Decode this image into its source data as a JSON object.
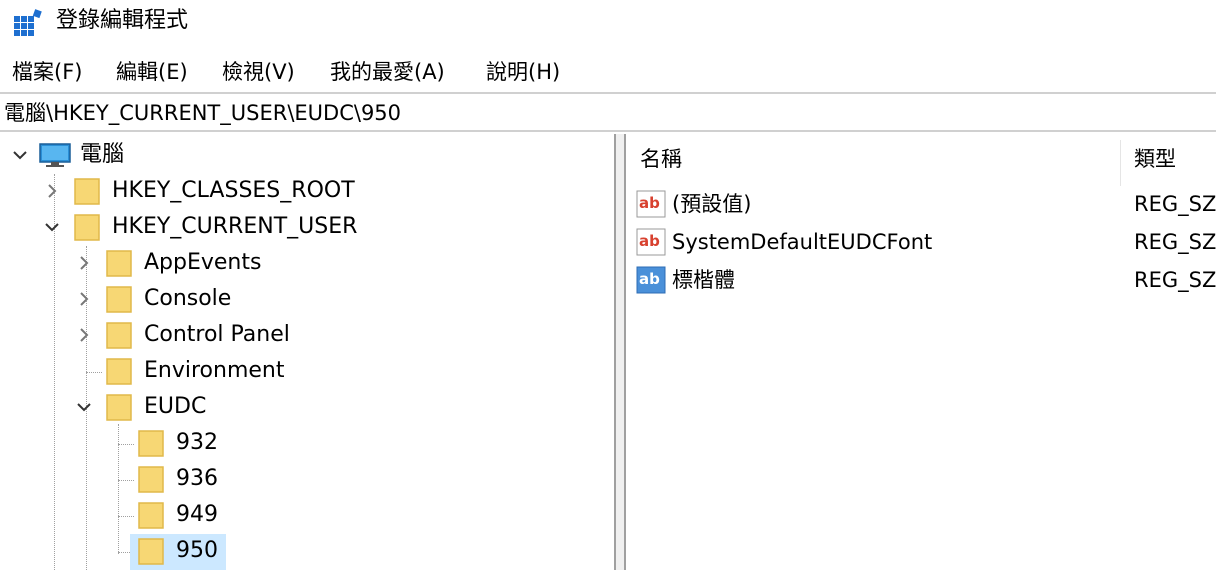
{
  "window": {
    "title": "登錄編輯程式",
    "icon": "registry-editor-icon"
  },
  "menu": [
    {
      "label": "檔案(F)"
    },
    {
      "label": "編輯(E)"
    },
    {
      "label": "檢視(V)"
    },
    {
      "label": "我的最愛(A)"
    },
    {
      "label": "說明(H)"
    }
  ],
  "address": {
    "path": "電腦\\HKEY_CURRENT_USER\\EUDC\\950"
  },
  "tree": {
    "computer": {
      "label": "電腦",
      "state": "expanded",
      "icon": "computer-icon"
    },
    "hkcr": {
      "label": "HKEY_CLASSES_ROOT",
      "state": "collapsed"
    },
    "hkcu": {
      "label": "HKEY_CURRENT_USER",
      "state": "expanded"
    },
    "appevents": {
      "label": "AppEvents",
      "state": "collapsed"
    },
    "console": {
      "label": "Console",
      "state": "collapsed"
    },
    "control_panel": {
      "label": "Control Panel",
      "state": "collapsed"
    },
    "environment": {
      "label": "Environment",
      "state": "leaf"
    },
    "eudc": {
      "label": "EUDC",
      "state": "expanded"
    },
    "k932": {
      "label": "932",
      "state": "leaf"
    },
    "k936": {
      "label": "936",
      "state": "leaf"
    },
    "k949": {
      "label": "949",
      "state": "leaf"
    },
    "k950": {
      "label": "950",
      "state": "leaf",
      "selected": true
    }
  },
  "values_pane": {
    "headers": {
      "name": "名稱",
      "type": "類型"
    },
    "rows": [
      {
        "name": "(預設值)",
        "type": "REG_SZ",
        "icon": "string-value-icon"
      },
      {
        "name": "SystemDefaultEUDCFont",
        "type": "REG_SZ",
        "icon": "string-value-icon"
      },
      {
        "name": "標楷體",
        "type": "REG_SZ",
        "icon": "string-value-selected-icon"
      }
    ]
  },
  "colors": {
    "selection": "#cce8ff",
    "folder": "#f7d774",
    "folder_edge": "#e0b84a",
    "value_icon_red": "#d8412f",
    "value_icon_blue": "#4a90d9"
  }
}
